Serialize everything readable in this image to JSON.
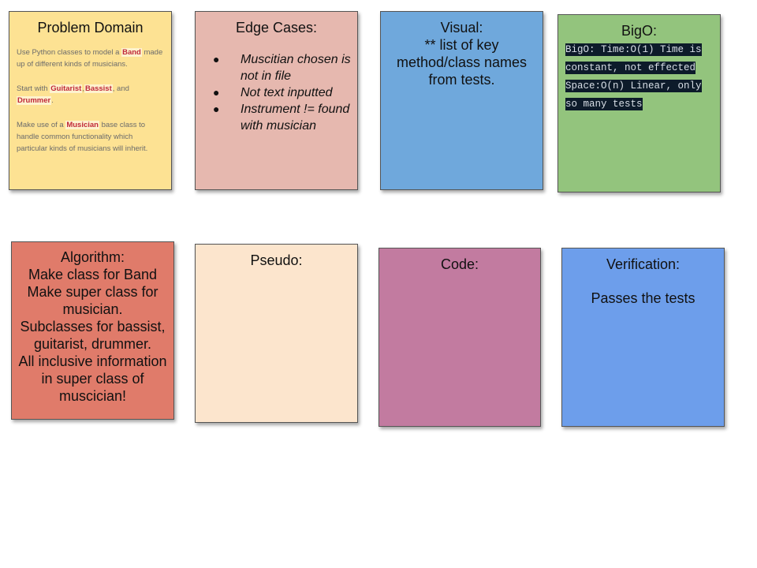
{
  "colors": {
    "problem_domain": "#fde293",
    "edge_cases": "#e6b8af",
    "visual": "#6fa8dc",
    "bigo": "#93c47d",
    "algorithm": "#e07b6a",
    "pseudo": "#fce5cd",
    "code": "#c27ba0",
    "verification": "#6d9eeb"
  },
  "problem_domain": {
    "title": "Problem Domain",
    "p1_a": "Use Python classes to model a ",
    "p1_kw": "Band",
    "p1_b": " made up of different kinds of musicians.",
    "p2_a": "Start with ",
    "p2_kw1": "Guitarist",
    "p2_sep": ",",
    "p2_kw2": "Bassist",
    "p2_b": ", and ",
    "p2_kw3": "Drummer",
    "p2_c": ".",
    "p3_a": "Make use of a ",
    "p3_kw": "Musician",
    "p3_b": " base class to handle common functionality which particular kinds of musicians will inherit."
  },
  "edge_cases": {
    "title": "Edge Cases:",
    "bullet": "●",
    "items": [
      "Muscitian chosen is not in file",
      "Not text inputted",
      "Instrument != found with musician"
    ]
  },
  "visual": {
    "title": "Visual:",
    "text": "** list of key method/class names from tests."
  },
  "bigo": {
    "title": "BigO:",
    "text": "BigO: Time:O(1) Time is constant, not effected Space:O(n) Linear, only so many tests"
  },
  "algorithm": {
    "title": "Algorithm:",
    "lines": [
      "Make class for Band",
      "Make super class for musician.",
      "Subclasses for bassist, guitarist, drummer.",
      "All inclusive information in super class of muscician!"
    ]
  },
  "pseudo": {
    "title": "Pseudo:"
  },
  "code": {
    "title": "Code:"
  },
  "verification": {
    "title": "Verification:",
    "text": "Passes the tests"
  }
}
